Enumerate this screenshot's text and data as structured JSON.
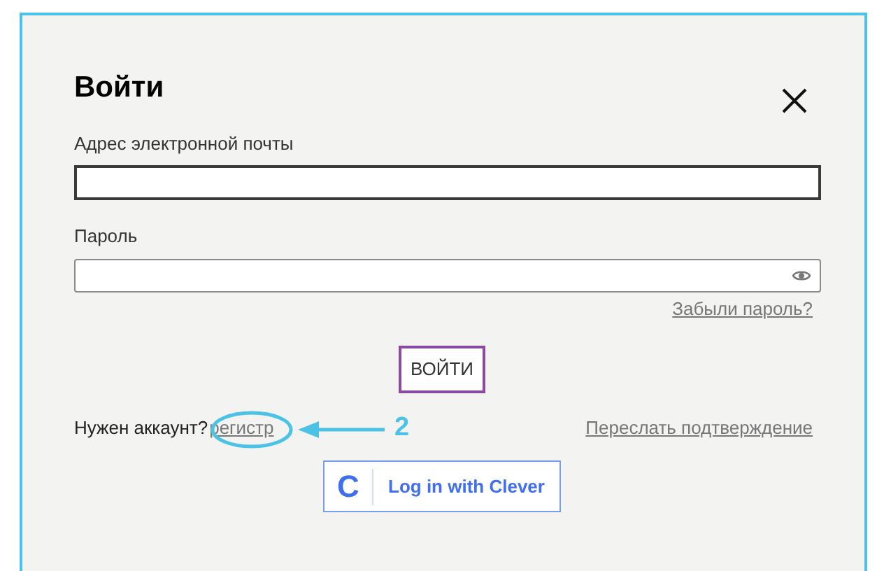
{
  "dialog": {
    "title": "Войти",
    "email_label": "Адрес электронной почты",
    "password_label": "Пароль",
    "forgot_link": "Забыли пароль?",
    "submit_button": "ВОЙТИ",
    "need_account": "Нужен аккаунт?",
    "register_link": "регистр",
    "resend_link": "Переслать подтверждение",
    "clever_logo": "C",
    "clever_button": "Log in with Clever"
  },
  "annotation": {
    "label": "2"
  }
}
